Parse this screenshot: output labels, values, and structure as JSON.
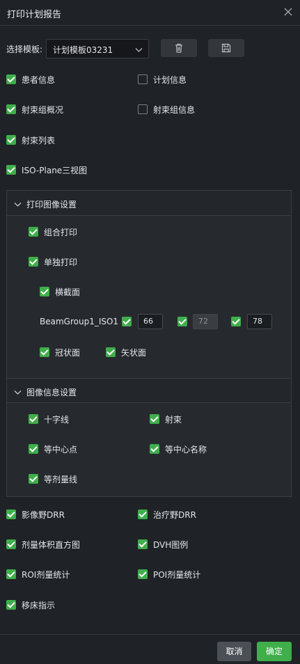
{
  "dialog": {
    "title": "打印计划报告"
  },
  "template": {
    "label": "选择模板:",
    "value": "计划模板03231"
  },
  "options": {
    "patient_info": {
      "label": "患者信息",
      "checked": true
    },
    "plan_info": {
      "label": "计划信息",
      "checked": false
    },
    "beam_group_overview": {
      "label": "射束组概况",
      "checked": true
    },
    "beam_group_info": {
      "label": "射束组信息",
      "checked": false
    },
    "beam_list": {
      "label": "射束列表",
      "checked": true
    },
    "iso_plane": {
      "label": "ISO-Plane三视图",
      "checked": true
    }
  },
  "print_image_settings": {
    "header": "打印图像设置",
    "combined": {
      "label": "组合打印",
      "checked": true
    },
    "separate": {
      "label": "单独打印",
      "checked": true
    },
    "transverse": {
      "label": "横截面",
      "checked": true
    },
    "beam_group": {
      "name": "BeamGroup1_ISO1",
      "values": [
        {
          "value": "66",
          "checked": true,
          "disabled": false
        },
        {
          "value": "72",
          "checked": true,
          "disabled": true
        },
        {
          "value": "78",
          "checked": true,
          "disabled": false
        }
      ]
    },
    "coronal": {
      "label": "冠状面",
      "checked": true
    },
    "sagittal": {
      "label": "矢状面",
      "checked": true
    }
  },
  "image_info_settings": {
    "header": "图像信息设置",
    "crosshair": {
      "label": "十字线",
      "checked": true
    },
    "beam": {
      "label": "射束",
      "checked": true
    },
    "isocenter": {
      "label": "等中心点",
      "checked": true
    },
    "isocenter_name": {
      "label": "等中心名称",
      "checked": true
    },
    "isodose": {
      "label": "等剂量线",
      "checked": true
    }
  },
  "bottom_options": {
    "image_field_drr": {
      "label": "影像野DRR",
      "checked": true
    },
    "treatment_field_drr": {
      "label": "治疗野DRR",
      "checked": true
    },
    "dvh": {
      "label": "剂量体积直方图",
      "checked": true
    },
    "dvh_legend": {
      "label": "DVH图例",
      "checked": true
    },
    "roi_stats": {
      "label": "ROI剂量统计",
      "checked": true
    },
    "poi_stats": {
      "label": "POI剂量统计",
      "checked": true
    },
    "couch_shift": {
      "label": "移床指示",
      "checked": true
    }
  },
  "footer": {
    "cancel_label": "取消",
    "ok_label": "确定"
  },
  "colors": {
    "accent": "#3fae4b",
    "background": "#1f2226",
    "panel": "#262a2e"
  }
}
